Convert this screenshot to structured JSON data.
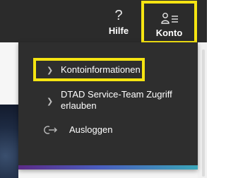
{
  "topbar": {
    "help": {
      "icon": "question-mark-icon",
      "glyph": "?",
      "label": "Hilfe"
    },
    "account": {
      "icon": "user-list-icon",
      "label": "Konto"
    }
  },
  "menu": {
    "items": [
      {
        "label": "Kontoinformationen",
        "icon": "chevron-right-icon"
      },
      {
        "label": "DTAD Service-Team Zugriff erlauben",
        "icon": "chevron-right-icon"
      },
      {
        "label": "Ausloggen",
        "icon": "logout-icon"
      }
    ]
  },
  "colors": {
    "topbar": "#2b2b2b",
    "menu": "#2e2e2e",
    "highlight": "#f5e412",
    "text": "#ffffff"
  }
}
